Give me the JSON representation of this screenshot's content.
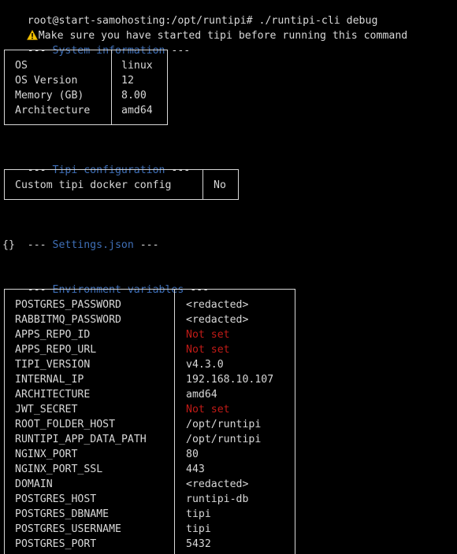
{
  "prompt": {
    "text": "root@start-samohosting:/opt/runtipi# ./runtipi-cli debug"
  },
  "warning": {
    "icon": "warning-icon",
    "text": "Make sure you have started tipi before running this command"
  },
  "sections": {
    "system_info_heading": "System information",
    "tipi_config_heading": "Tipi configuration",
    "settings_heading": "Settings.json",
    "env_heading": "Environment variables",
    "dashes": "---"
  },
  "system_info": {
    "rows": [
      {
        "key": "OS",
        "value": "linux"
      },
      {
        "key": "OS Version",
        "value": "12"
      },
      {
        "key": "Memory (GB)",
        "value": "8.00"
      },
      {
        "key": "Architecture",
        "value": "amd64"
      }
    ]
  },
  "tipi_config": {
    "key": "Custom tipi docker config",
    "value": "No"
  },
  "settings_json": {
    "content": "{}"
  },
  "env": {
    "rows": [
      {
        "key": "POSTGRES_PASSWORD",
        "value": "<redacted>",
        "status": "set"
      },
      {
        "key": "RABBITMQ_PASSWORD",
        "value": "<redacted>",
        "status": "set"
      },
      {
        "key": "APPS_REPO_ID",
        "value": "Not set",
        "status": "notset"
      },
      {
        "key": "APPS_REPO_URL",
        "value": "Not set",
        "status": "notset"
      },
      {
        "key": "TIPI_VERSION",
        "value": "v4.3.0",
        "status": "set"
      },
      {
        "key": "INTERNAL_IP",
        "value": "192.168.10.107",
        "status": "set"
      },
      {
        "key": "ARCHITECTURE",
        "value": "amd64",
        "status": "set"
      },
      {
        "key": "JWT_SECRET",
        "value": "Not set",
        "status": "notset"
      },
      {
        "key": "ROOT_FOLDER_HOST",
        "value": "/opt/runtipi",
        "status": "set"
      },
      {
        "key": "RUNTIPI_APP_DATA_PATH",
        "value": "/opt/runtipi",
        "status": "set"
      },
      {
        "key": "NGINX_PORT",
        "value": "80",
        "status": "set"
      },
      {
        "key": "NGINX_PORT_SSL",
        "value": "443",
        "status": "set"
      },
      {
        "key": "DOMAIN",
        "value": "<redacted>",
        "status": "set"
      },
      {
        "key": "POSTGRES_HOST",
        "value": "runtipi-db",
        "status": "set"
      },
      {
        "key": "POSTGRES_DBNAME",
        "value": "tipi",
        "status": "set"
      },
      {
        "key": "POSTGRES_USERNAME",
        "value": "tipi",
        "status": "set"
      },
      {
        "key": "POSTGRES_PORT",
        "value": "5432",
        "status": "set"
      }
    ]
  },
  "colors": {
    "background": "#000000",
    "text": "#d8d8d8",
    "heading": "#3f6fb7",
    "not_set": "#c11b17",
    "warning": "#f2c200"
  }
}
